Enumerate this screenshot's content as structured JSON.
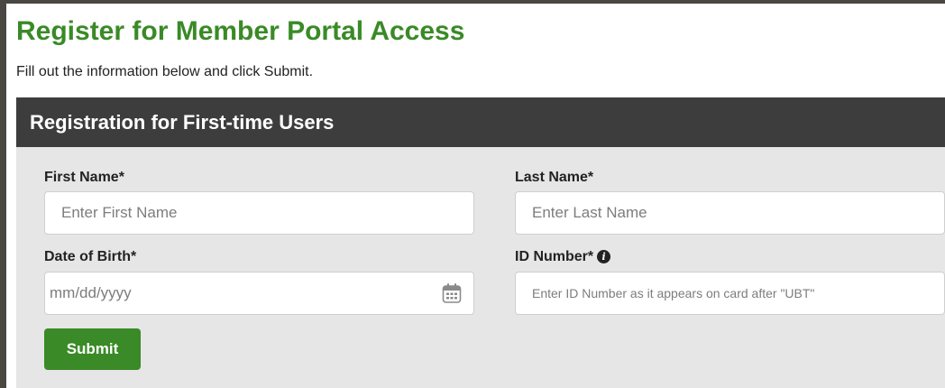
{
  "page": {
    "title": "Register for Member Portal Access",
    "subtitle": "Fill out the information below and click Submit."
  },
  "panel": {
    "header": "Registration for First-time Users"
  },
  "form": {
    "first_name": {
      "label": "First Name*",
      "placeholder": "Enter First Name",
      "value": ""
    },
    "last_name": {
      "label": "Last Name*",
      "placeholder": "Enter Last Name",
      "value": ""
    },
    "dob": {
      "label": "Date of Birth*",
      "placeholder": "mm/dd/yyyy",
      "value": "",
      "icon": "calendar-icon"
    },
    "id_number": {
      "label": "ID Number*",
      "info_icon": "info-icon",
      "placeholder": "Enter ID Number as it appears on card after \"UBT\"",
      "value": ""
    },
    "submit_label": "Submit"
  },
  "colors": {
    "brand_green": "#3a8a27",
    "panel_header_bg": "#3d3d3d",
    "panel_bg": "#e6e6e6",
    "frame_bg": "#4a4642"
  }
}
